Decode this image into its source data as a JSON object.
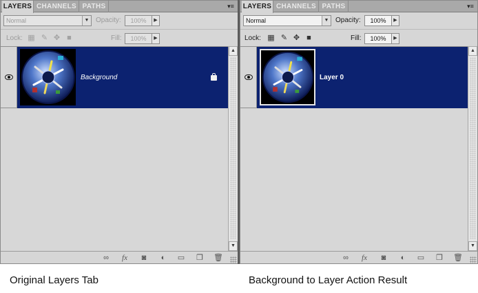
{
  "tabs": [
    "LAYERS",
    "CHANNELS",
    "PATHS"
  ],
  "controls": {
    "lock_label": "Lock:",
    "opacity_label": "Opacity:",
    "fill_label": "Fill:"
  },
  "left_panel": {
    "blend_mode": "Normal",
    "opacity": "100%",
    "fill": "100%",
    "layer_name": "Background"
  },
  "right_panel": {
    "blend_mode": "Normal",
    "opacity": "100%",
    "fill": "100%",
    "layer_name": "Layer 0"
  },
  "icons": {
    "panel_menu": "panel-menu-icon",
    "eye": "eye-icon",
    "lock_transparent": "lock-transparent-icon",
    "lock_image": "lock-image-icon",
    "lock_position": "lock-position-icon",
    "lock_all": "lock-all-icon",
    "toolbar": [
      "link-icon",
      "fx-icon",
      "mask-icon",
      "adjustment-icon",
      "group-folder-icon",
      "new-layer-icon",
      "trash-icon"
    ]
  },
  "captions": {
    "left": "Original Layers Tab",
    "right": "Background to Layer Action Result"
  }
}
